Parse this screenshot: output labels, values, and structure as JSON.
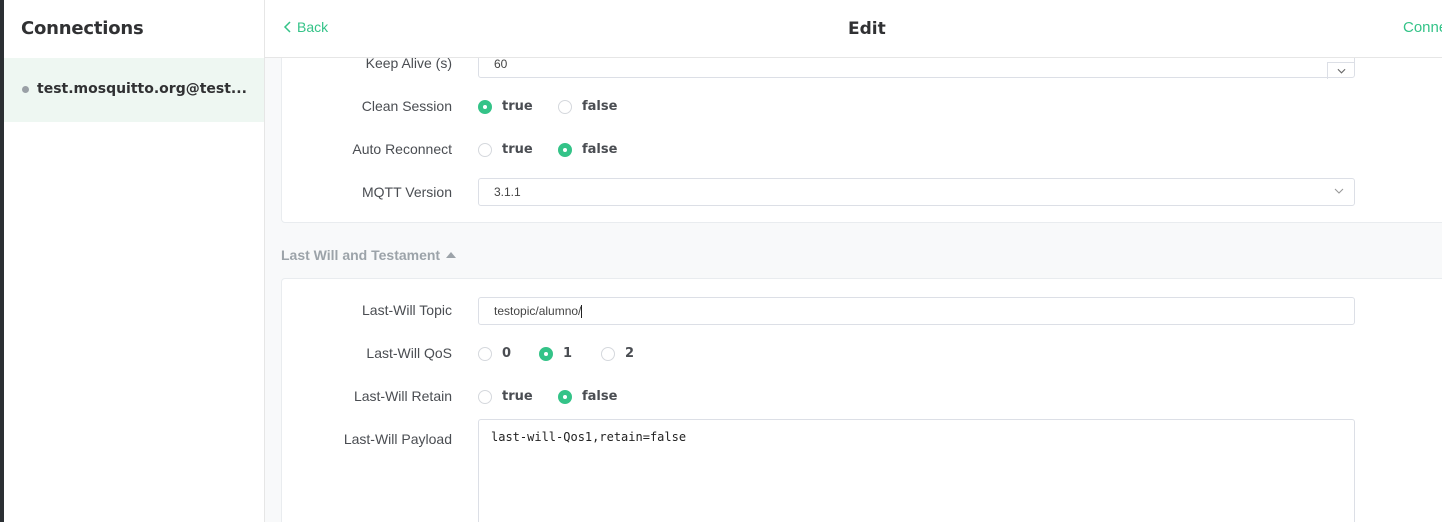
{
  "sidebar": {
    "title": "Connections",
    "connections": [
      {
        "label": "test.mosquitto.org@test..."
      }
    ]
  },
  "header": {
    "back_label": "Back",
    "title": "Edit",
    "connect_label": "Conne"
  },
  "general": {
    "keep_alive": {
      "label": "Keep Alive (s)",
      "value": "60"
    },
    "clean_session": {
      "label": "Clean Session",
      "options": [
        "true",
        "false"
      ],
      "selected": "true"
    },
    "auto_reconnect": {
      "label": "Auto Reconnect",
      "options": [
        "true",
        "false"
      ],
      "selected": "false"
    },
    "mqtt_version": {
      "label": "MQTT Version",
      "value": "3.1.1"
    }
  },
  "lwt": {
    "section_title": "Last Will and Testament",
    "topic": {
      "label": "Last-Will Topic",
      "value": "testopic/alumno/"
    },
    "qos": {
      "label": "Last-Will QoS",
      "options": [
        "0",
        "1",
        "2"
      ],
      "selected": "1"
    },
    "retain": {
      "label": "Last-Will Retain",
      "options": [
        "true",
        "false"
      ],
      "selected": "false"
    },
    "payload": {
      "label": "Last-Will Payload",
      "value": "last-will-Qos1,retain=false"
    }
  },
  "colors": {
    "accent": "#34c388",
    "sidebar_active": "#eef7f2"
  }
}
